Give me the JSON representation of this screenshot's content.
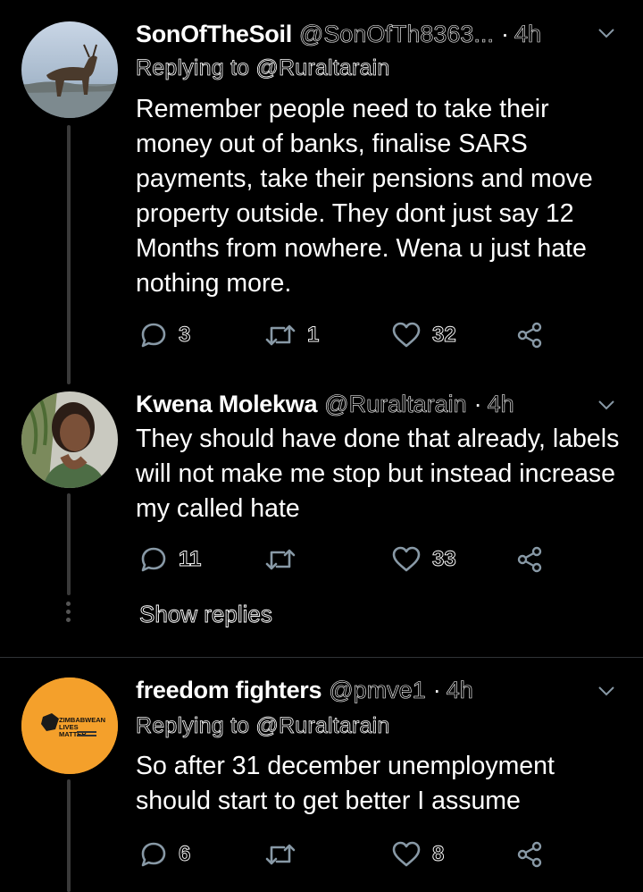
{
  "tweets": [
    {
      "name": "SonOfTheSoil",
      "handle": "@SonOfTh8363...",
      "dot": "·",
      "time": "4h",
      "replying": "Replying to @Ruraltarain",
      "text": "Remember people need to take their money out of banks, finalise SARS payments, take their pensions and move property outside. They dont just say 12 Months from nowhere. Wena u just hate nothing more.",
      "replies": "3",
      "retweets": "1",
      "likes": "32",
      "avatar_icon": "goat-avatar-icon"
    },
    {
      "name": "Kwena Molekwa",
      "handle": "@Ruraltarain",
      "dot": "·",
      "time": "4h",
      "text": "They should have done that already, labels will not make me stop but instead increase my called hate",
      "replies": "11",
      "retweets": "",
      "likes": "33",
      "avatar_icon": "person-avatar-icon"
    },
    {
      "name": "freedom fighters",
      "handle": "@pmve1",
      "dot": "·",
      "time": "4h",
      "replying": "Replying to @Ruraltarain",
      "text": "So after 31 december unemployment should start to get better I assume",
      "replies": "6",
      "retweets": "",
      "likes": "8",
      "avatar_icon": "logo-avatar-icon"
    }
  ],
  "show_replies": "Show replies",
  "logo": {
    "line1": "ZIMBABWEAN",
    "line2": "LIVES",
    "line3": "MATTER"
  },
  "colors": {
    "background": "#000000",
    "icon": "#8899a6",
    "divider": "#2f3336",
    "thread": "#3a3a3a",
    "logo_bg": "#f4a02b"
  }
}
